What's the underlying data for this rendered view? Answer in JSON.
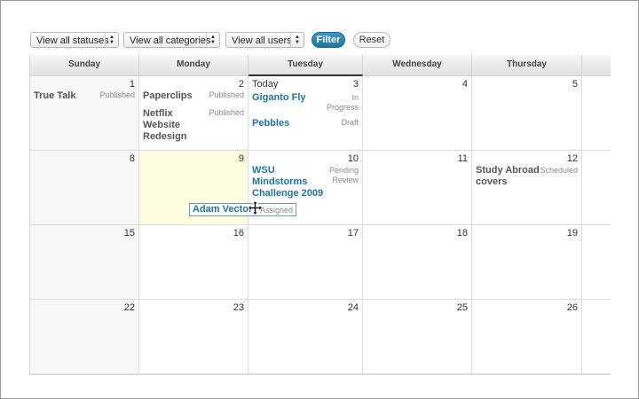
{
  "filters": {
    "statuses": "View all statuses",
    "categories": "View all categories",
    "users": "View all users",
    "filter_button": "Filter",
    "reset_button": "Reset"
  },
  "days": [
    "Sunday",
    "Monday",
    "Tuesday",
    "Wednesday",
    "Thursday"
  ],
  "today_label": "Today",
  "weeks": [
    [
      "1",
      "2",
      "3",
      "4",
      "5"
    ],
    [
      "8",
      "9",
      "10",
      "11",
      "12"
    ],
    [
      "15",
      "16",
      "17",
      "18",
      "19"
    ],
    [
      "22",
      "23",
      "24",
      "25",
      "26"
    ]
  ],
  "posts": {
    "true_talk": {
      "title": "True Talk",
      "status": "Published"
    },
    "paperclips": {
      "title": "Paperclips",
      "status": "Published"
    },
    "netflix": {
      "title_lines": [
        "Netflix",
        "Website",
        "Redesign"
      ],
      "status": "Published"
    },
    "giganto": {
      "title": "Giganto Fly",
      "status_lines": [
        "In",
        "Progress"
      ]
    },
    "pebbles": {
      "title": "Pebbles",
      "status": "Draft"
    },
    "wsu": {
      "title_lines": [
        "WSU",
        "Mindstorms",
        "Challenge 2009"
      ],
      "status_lines": [
        "Pending",
        "Review"
      ]
    },
    "study_abroad": {
      "title_lines": [
        "Study Abroad",
        "covers"
      ],
      "status": "Scheduled"
    },
    "adam_vector": {
      "title": "Adam Vector",
      "status": "Assigned"
    }
  }
}
